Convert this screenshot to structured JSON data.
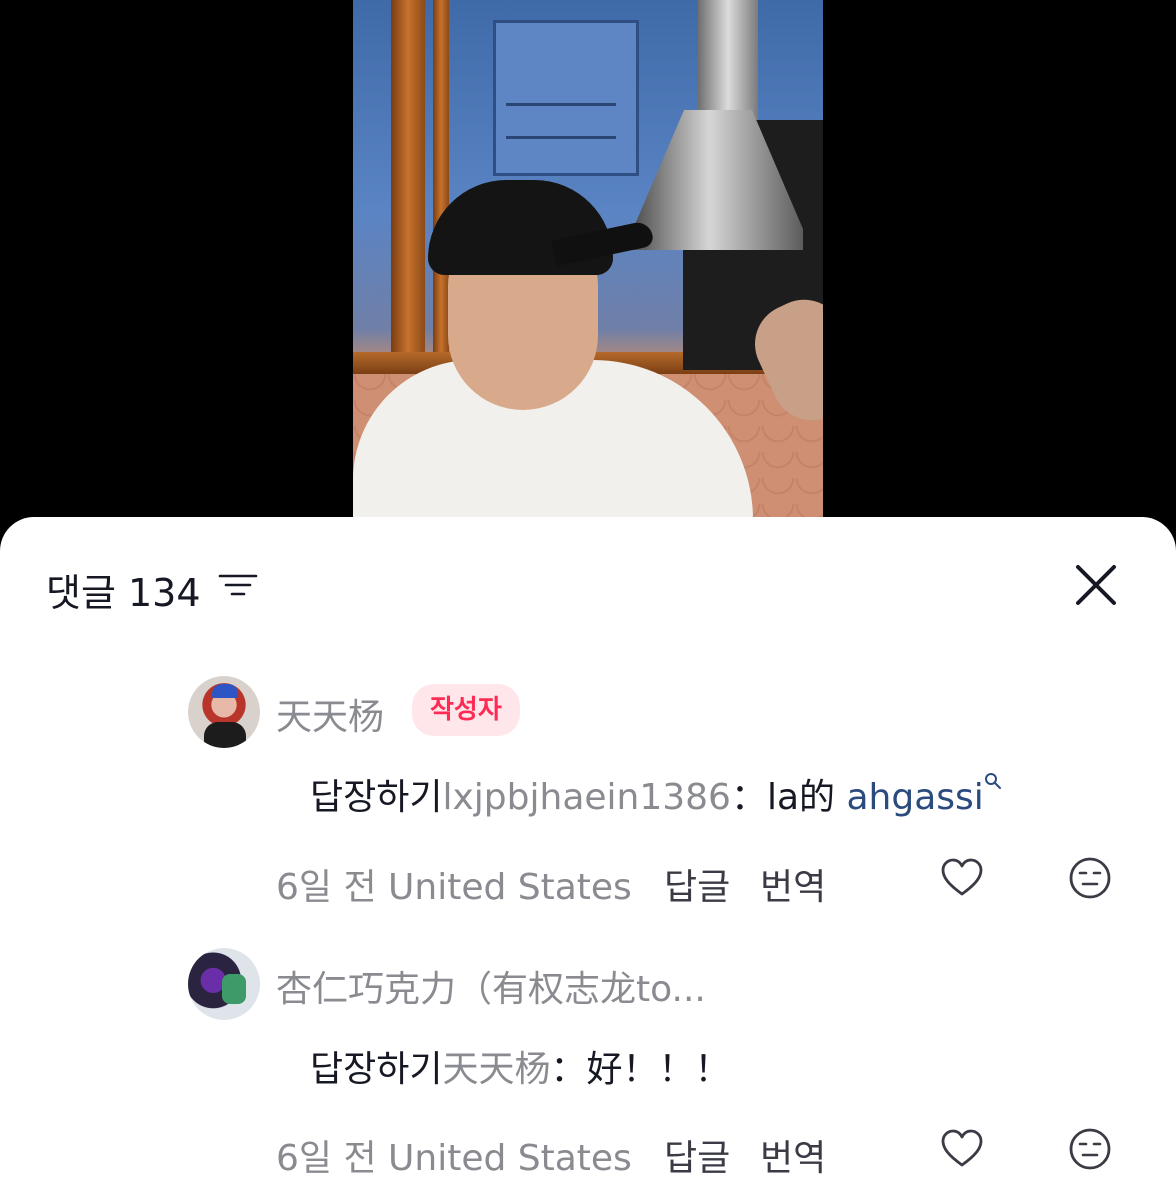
{
  "header": {
    "title": "댓글 134"
  },
  "comments": [
    {
      "username": "天天杨",
      "badge": "작성자",
      "reply_prefix": "답장하기",
      "reply_target": "lxjpbjhaein1386",
      "text_before_link": "：la的 ",
      "link_text": "ahgassi",
      "meta": "6일 전 United States",
      "reply_label": "답글",
      "translate_label": "번역"
    },
    {
      "username": "杏仁巧克力（有权志龙to...",
      "reply_prefix": "답장하기",
      "reply_target": "天天杨",
      "text": "：好！！！",
      "meta": "6일 전 United States",
      "reply_label": "답글",
      "translate_label": "번역"
    }
  ],
  "icons": {
    "sort": "sort-icon",
    "close": "close-icon",
    "like": "heart-icon",
    "dislike": "neutral-face-icon",
    "search": "search-icon"
  },
  "colors": {
    "badge_text": "#fe2c55",
    "badge_bg": "#ffe6ea",
    "link": "#2b4a7e",
    "muted": "#8a8b91"
  }
}
